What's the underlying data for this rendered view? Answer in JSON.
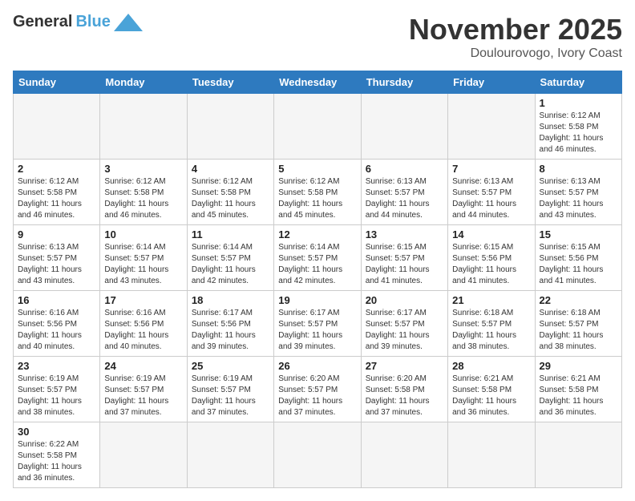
{
  "header": {
    "logo_general": "General",
    "logo_blue": "Blue",
    "month_title": "November 2025",
    "location": "Doulourovogo, Ivory Coast"
  },
  "weekdays": [
    "Sunday",
    "Monday",
    "Tuesday",
    "Wednesday",
    "Thursday",
    "Friday",
    "Saturday"
  ],
  "weeks": [
    [
      {
        "day": "",
        "info": ""
      },
      {
        "day": "",
        "info": ""
      },
      {
        "day": "",
        "info": ""
      },
      {
        "day": "",
        "info": ""
      },
      {
        "day": "",
        "info": ""
      },
      {
        "day": "",
        "info": ""
      },
      {
        "day": "1",
        "info": "Sunrise: 6:12 AM\nSunset: 5:58 PM\nDaylight: 11 hours and 46 minutes."
      }
    ],
    [
      {
        "day": "2",
        "info": "Sunrise: 6:12 AM\nSunset: 5:58 PM\nDaylight: 11 hours and 46 minutes."
      },
      {
        "day": "3",
        "info": "Sunrise: 6:12 AM\nSunset: 5:58 PM\nDaylight: 11 hours and 46 minutes."
      },
      {
        "day": "4",
        "info": "Sunrise: 6:12 AM\nSunset: 5:58 PM\nDaylight: 11 hours and 45 minutes."
      },
      {
        "day": "5",
        "info": "Sunrise: 6:12 AM\nSunset: 5:58 PM\nDaylight: 11 hours and 45 minutes."
      },
      {
        "day": "6",
        "info": "Sunrise: 6:13 AM\nSunset: 5:57 PM\nDaylight: 11 hours and 44 minutes."
      },
      {
        "day": "7",
        "info": "Sunrise: 6:13 AM\nSunset: 5:57 PM\nDaylight: 11 hours and 44 minutes."
      },
      {
        "day": "8",
        "info": "Sunrise: 6:13 AM\nSunset: 5:57 PM\nDaylight: 11 hours and 43 minutes."
      }
    ],
    [
      {
        "day": "9",
        "info": "Sunrise: 6:13 AM\nSunset: 5:57 PM\nDaylight: 11 hours and 43 minutes."
      },
      {
        "day": "10",
        "info": "Sunrise: 6:14 AM\nSunset: 5:57 PM\nDaylight: 11 hours and 43 minutes."
      },
      {
        "day": "11",
        "info": "Sunrise: 6:14 AM\nSunset: 5:57 PM\nDaylight: 11 hours and 42 minutes."
      },
      {
        "day": "12",
        "info": "Sunrise: 6:14 AM\nSunset: 5:57 PM\nDaylight: 11 hours and 42 minutes."
      },
      {
        "day": "13",
        "info": "Sunrise: 6:15 AM\nSunset: 5:57 PM\nDaylight: 11 hours and 41 minutes."
      },
      {
        "day": "14",
        "info": "Sunrise: 6:15 AM\nSunset: 5:56 PM\nDaylight: 11 hours and 41 minutes."
      },
      {
        "day": "15",
        "info": "Sunrise: 6:15 AM\nSunset: 5:56 PM\nDaylight: 11 hours and 41 minutes."
      }
    ],
    [
      {
        "day": "16",
        "info": "Sunrise: 6:16 AM\nSunset: 5:56 PM\nDaylight: 11 hours and 40 minutes."
      },
      {
        "day": "17",
        "info": "Sunrise: 6:16 AM\nSunset: 5:56 PM\nDaylight: 11 hours and 40 minutes."
      },
      {
        "day": "18",
        "info": "Sunrise: 6:17 AM\nSunset: 5:56 PM\nDaylight: 11 hours and 39 minutes."
      },
      {
        "day": "19",
        "info": "Sunrise: 6:17 AM\nSunset: 5:57 PM\nDaylight: 11 hours and 39 minutes."
      },
      {
        "day": "20",
        "info": "Sunrise: 6:17 AM\nSunset: 5:57 PM\nDaylight: 11 hours and 39 minutes."
      },
      {
        "day": "21",
        "info": "Sunrise: 6:18 AM\nSunset: 5:57 PM\nDaylight: 11 hours and 38 minutes."
      },
      {
        "day": "22",
        "info": "Sunrise: 6:18 AM\nSunset: 5:57 PM\nDaylight: 11 hours and 38 minutes."
      }
    ],
    [
      {
        "day": "23",
        "info": "Sunrise: 6:19 AM\nSunset: 5:57 PM\nDaylight: 11 hours and 38 minutes."
      },
      {
        "day": "24",
        "info": "Sunrise: 6:19 AM\nSunset: 5:57 PM\nDaylight: 11 hours and 37 minutes."
      },
      {
        "day": "25",
        "info": "Sunrise: 6:19 AM\nSunset: 5:57 PM\nDaylight: 11 hours and 37 minutes."
      },
      {
        "day": "26",
        "info": "Sunrise: 6:20 AM\nSunset: 5:57 PM\nDaylight: 11 hours and 37 minutes."
      },
      {
        "day": "27",
        "info": "Sunrise: 6:20 AM\nSunset: 5:58 PM\nDaylight: 11 hours and 37 minutes."
      },
      {
        "day": "28",
        "info": "Sunrise: 6:21 AM\nSunset: 5:58 PM\nDaylight: 11 hours and 36 minutes."
      },
      {
        "day": "29",
        "info": "Sunrise: 6:21 AM\nSunset: 5:58 PM\nDaylight: 11 hours and 36 minutes."
      }
    ],
    [
      {
        "day": "30",
        "info": "Sunrise: 6:22 AM\nSunset: 5:58 PM\nDaylight: 11 hours and 36 minutes."
      },
      {
        "day": "",
        "info": ""
      },
      {
        "day": "",
        "info": ""
      },
      {
        "day": "",
        "info": ""
      },
      {
        "day": "",
        "info": ""
      },
      {
        "day": "",
        "info": ""
      },
      {
        "day": "",
        "info": ""
      }
    ]
  ]
}
